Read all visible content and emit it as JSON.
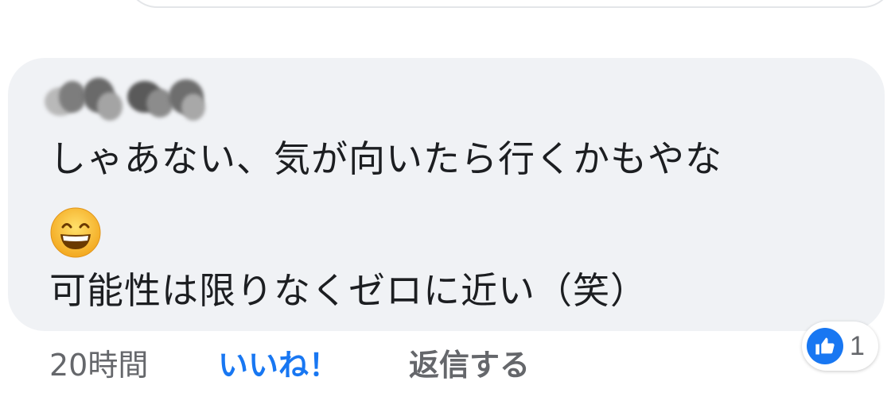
{
  "comment": {
    "author_name": "",
    "body_line1": "しゃあない、気が向いたら行くかもやな",
    "emoji": "grinning-face-with-smiling-eyes",
    "body_line2": "可能性は限りなくゼロに近い（笑）"
  },
  "actions": {
    "timestamp": "20時間",
    "like_label": "いいね！",
    "reply_label": "返信する"
  },
  "reactions": {
    "type": "like",
    "count": "1"
  },
  "colors": {
    "bubble_bg": "#f0f2f5",
    "link_blue": "#1877f2",
    "meta_gray": "#65676b",
    "text": "#1c1e21"
  }
}
